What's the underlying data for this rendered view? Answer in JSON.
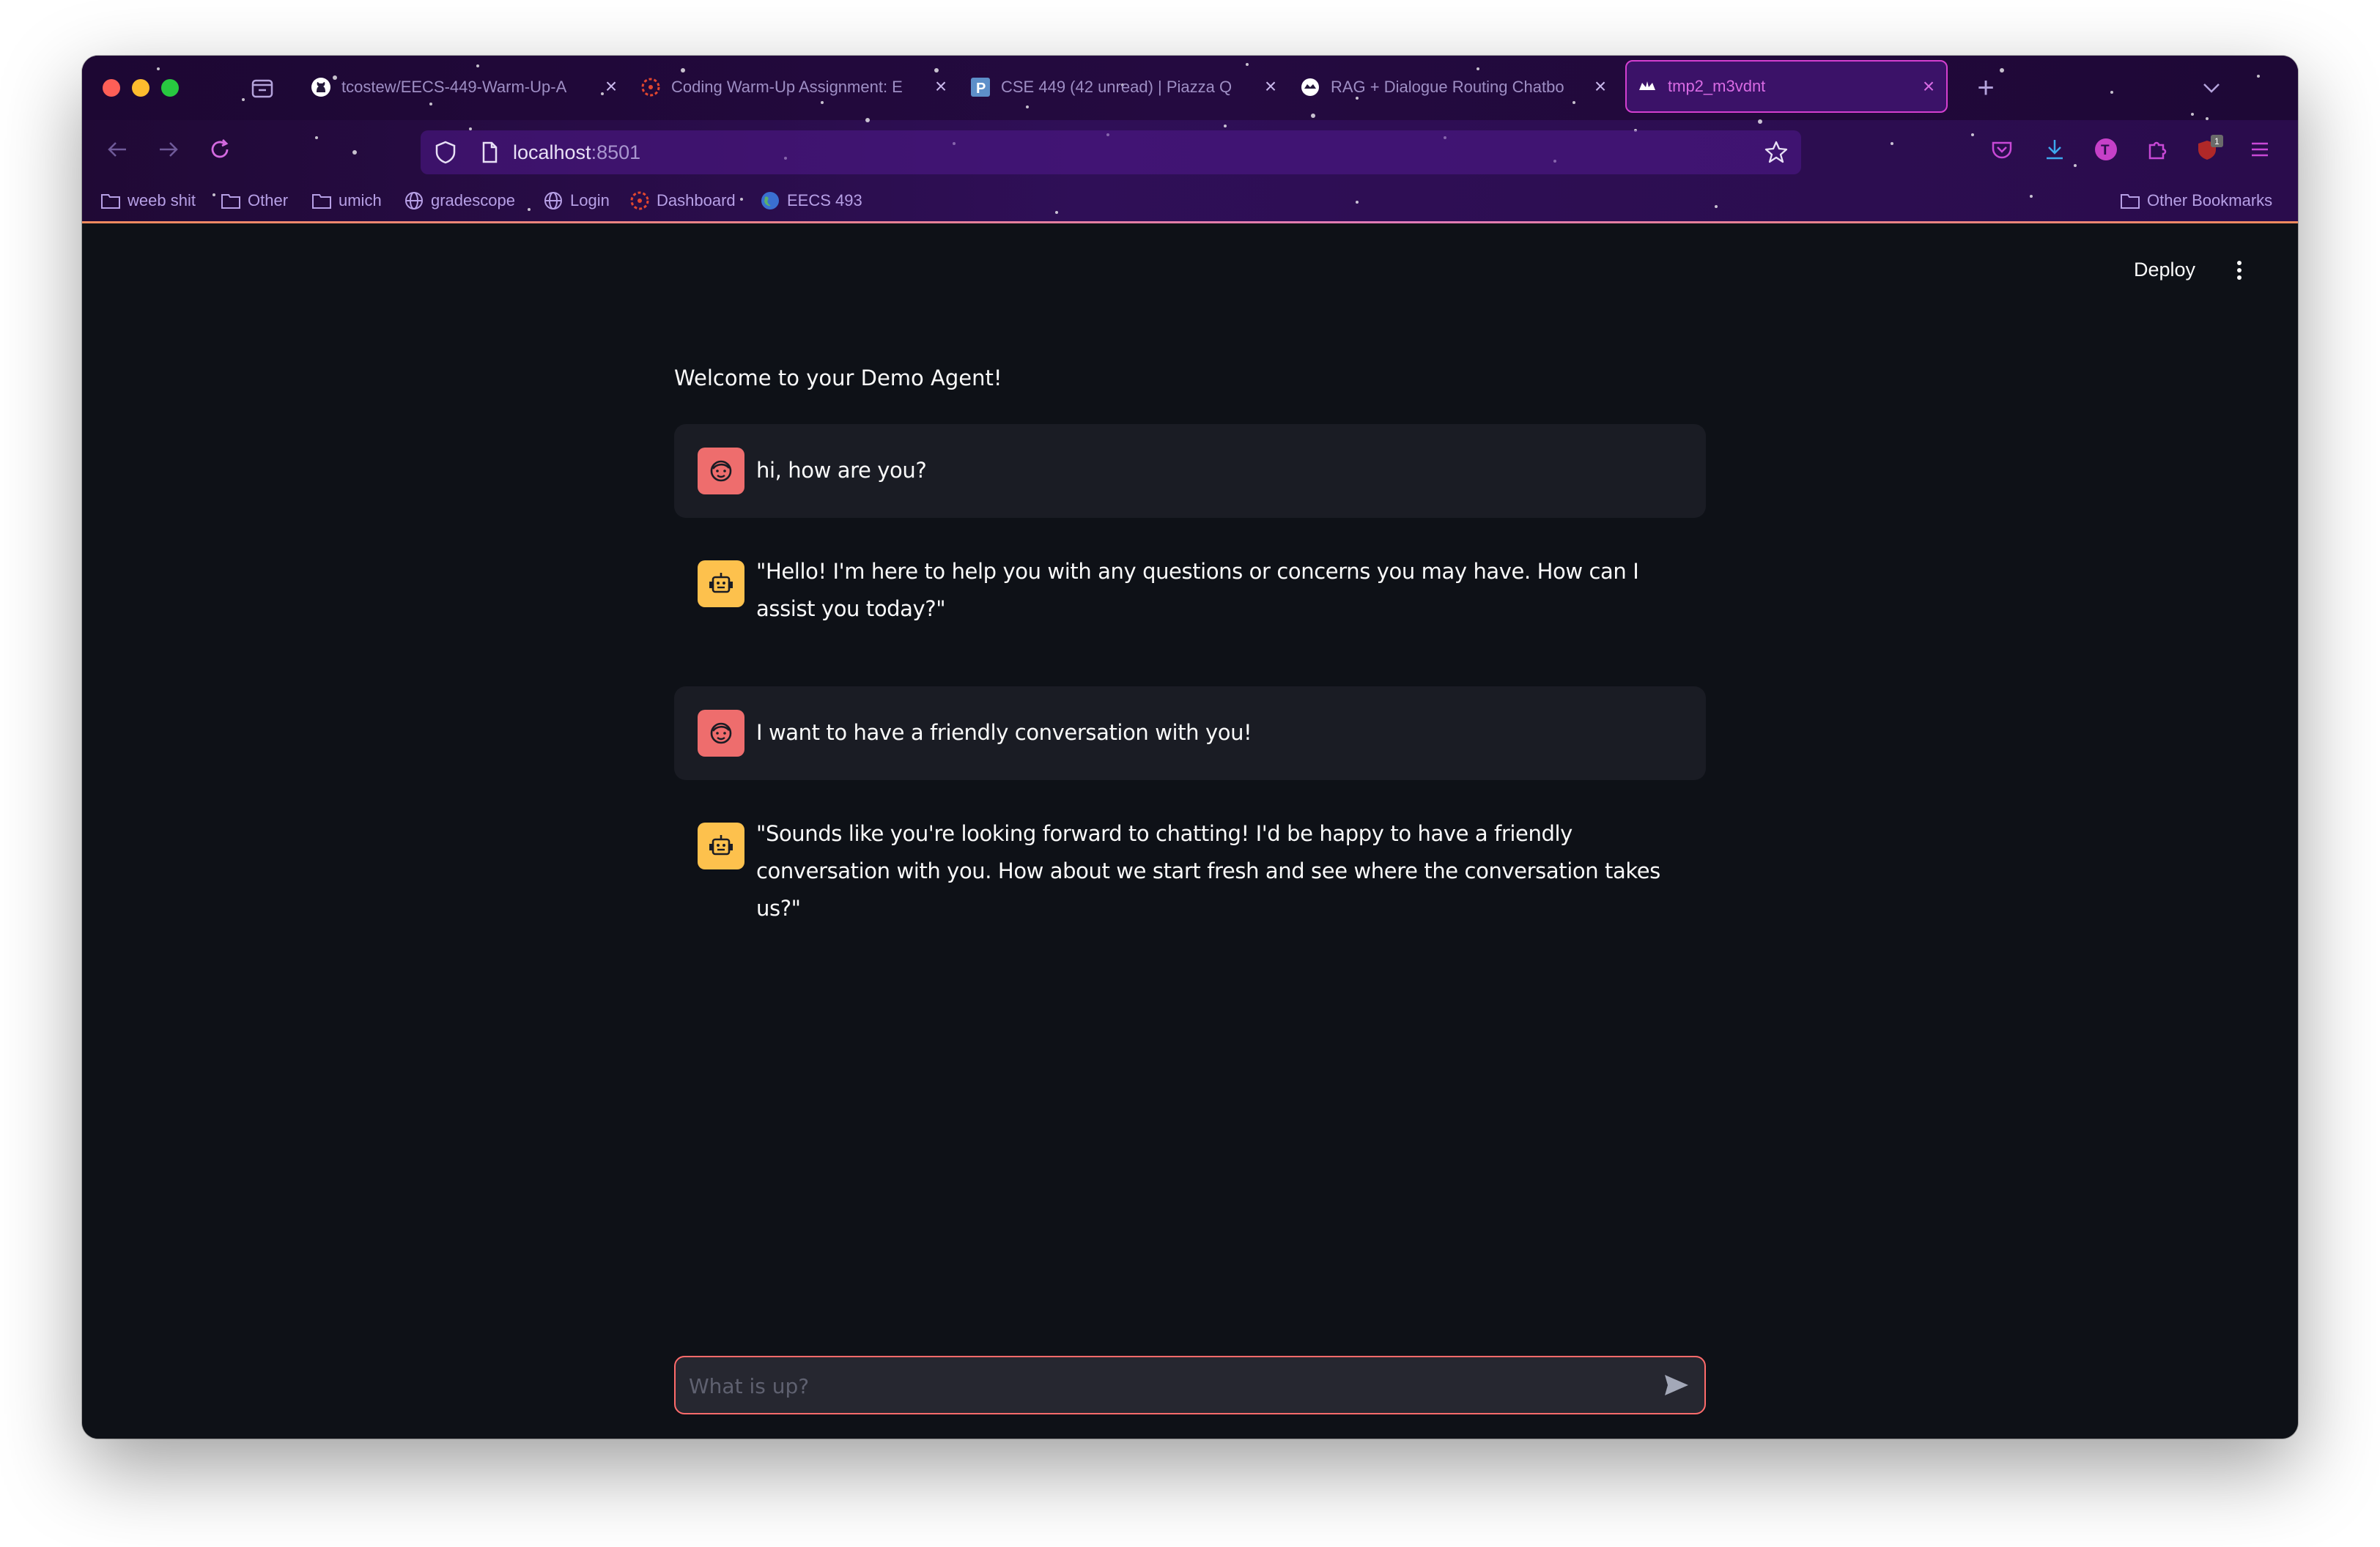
{
  "browser": {
    "tabs": [
      {
        "title": "tcostew/EECS-449-Warm-Up-A",
        "icon": "github-icon"
      },
      {
        "title": "Coding Warm-Up Assignment: E",
        "icon": "canvas-icon"
      },
      {
        "title": "CSE 449 (42 unread) | Piazza Q",
        "icon": "piazza-icon"
      },
      {
        "title": "RAG + Dialogue Routing Chatbo",
        "icon": "streamlit-icon"
      },
      {
        "title": "tmp2_m3vdnt",
        "icon": "streamlit-icon",
        "active": true
      }
    ],
    "url": {
      "host": "localhost",
      "port": ":8501"
    },
    "extension_badge": "1",
    "profile_initial": "T",
    "bookmarks": [
      {
        "label": "weeb shit",
        "icon": "folder-icon"
      },
      {
        "label": "Other",
        "icon": "folder-icon"
      },
      {
        "label": "umich",
        "icon": "folder-icon"
      },
      {
        "label": "gradescope",
        "icon": "globe-icon"
      },
      {
        "label": "Login",
        "icon": "globe-icon"
      },
      {
        "label": "Dashboard",
        "icon": "canvas-icon"
      },
      {
        "label": "EECS 493",
        "icon": "earth-icon"
      }
    ],
    "other_bookmarks": "Other Bookmarks"
  },
  "app": {
    "deploy_label": "Deploy",
    "welcome": "Welcome to your Demo Agent!",
    "messages": [
      {
        "role": "user",
        "text": "hi, how are you?"
      },
      {
        "role": "assistant",
        "text": "\"Hello! I'm here to help you with any questions or concerns you may have. How can I assist you today?\""
      },
      {
        "role": "user",
        "text": "I want to have a friendly conversation with you!"
      },
      {
        "role": "assistant",
        "text": "\"Sounds like you're looking forward to chatting! I'd be happy to have a friendly conversation with you. How about we start fresh and see where the conversation takes us?\""
      }
    ],
    "input": {
      "placeholder": "What is up?",
      "value": ""
    }
  },
  "colors": {
    "user_avatar": "#ee6d6d",
    "assistant_avatar": "#fdc14d",
    "input_border": "#ff6b6b",
    "tab_active_border": "#d43fd0"
  }
}
